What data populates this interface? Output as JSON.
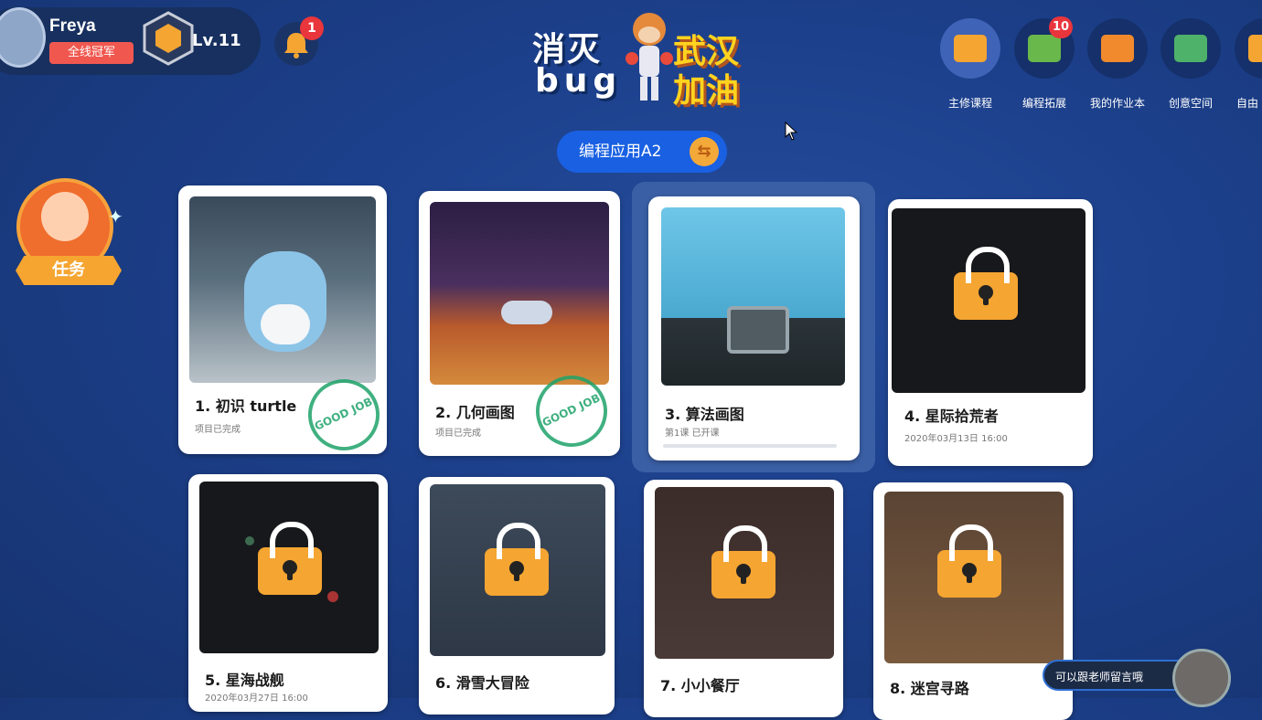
{
  "user": {
    "name": "Freya",
    "badge": "全线冠军",
    "level": "Lv.11",
    "notifications": "1"
  },
  "logo": {
    "line1": "消灭",
    "line2": "bug",
    "accent1": "武汉",
    "accent2": "加油"
  },
  "nav": [
    {
      "label": "主修课程",
      "icon": "video-course-icon",
      "color": "#f5a532",
      "active": true
    },
    {
      "label": "编程拓展",
      "icon": "folder-icon",
      "color": "#69b84b",
      "badge": "10"
    },
    {
      "label": "我的作业本",
      "icon": "notebook-icon",
      "color": "#f08a2c"
    },
    {
      "label": "创意空间",
      "icon": "map-icon",
      "color": "#4fb26a"
    },
    {
      "label": "自由",
      "icon": "free-icon",
      "color": "#f5a532"
    }
  ],
  "course_selector": {
    "label": "编程应用A2",
    "swap_icon": "swap-icon"
  },
  "task": {
    "label": "任务"
  },
  "lessons": [
    {
      "number": "1.",
      "title": "初识 turtle",
      "status": "项目已完成",
      "stamp": "GOOD JOB",
      "locked": false
    },
    {
      "number": "2.",
      "title": "几何画图",
      "status": "项目已完成",
      "stamp": "GOOD JOB",
      "locked": false
    },
    {
      "number": "3.",
      "title": "算法画图",
      "status": "第1课 已开课",
      "locked": false,
      "selected": true
    },
    {
      "number": "4.",
      "title": "星际拾荒者",
      "status": "2020年03月13日 16:00",
      "locked": true
    },
    {
      "number": "5.",
      "title": "星海战舰",
      "status": "2020年03月27日 16:00",
      "locked": true
    },
    {
      "number": "6.",
      "title": "滑雪大冒险",
      "status": "",
      "locked": true
    },
    {
      "number": "7.",
      "title": "小小餐厅",
      "status": "",
      "locked": true
    },
    {
      "number": "8.",
      "title": "迷宫寻路",
      "status": "",
      "locked": true
    }
  ],
  "message": {
    "label": "可以跟老师留言哦"
  },
  "colors": {
    "background": "#1c3f8a",
    "accent_blue": "#1960e2",
    "lock_orange": "#f5a532",
    "stamp_green": "#1fa36b"
  }
}
